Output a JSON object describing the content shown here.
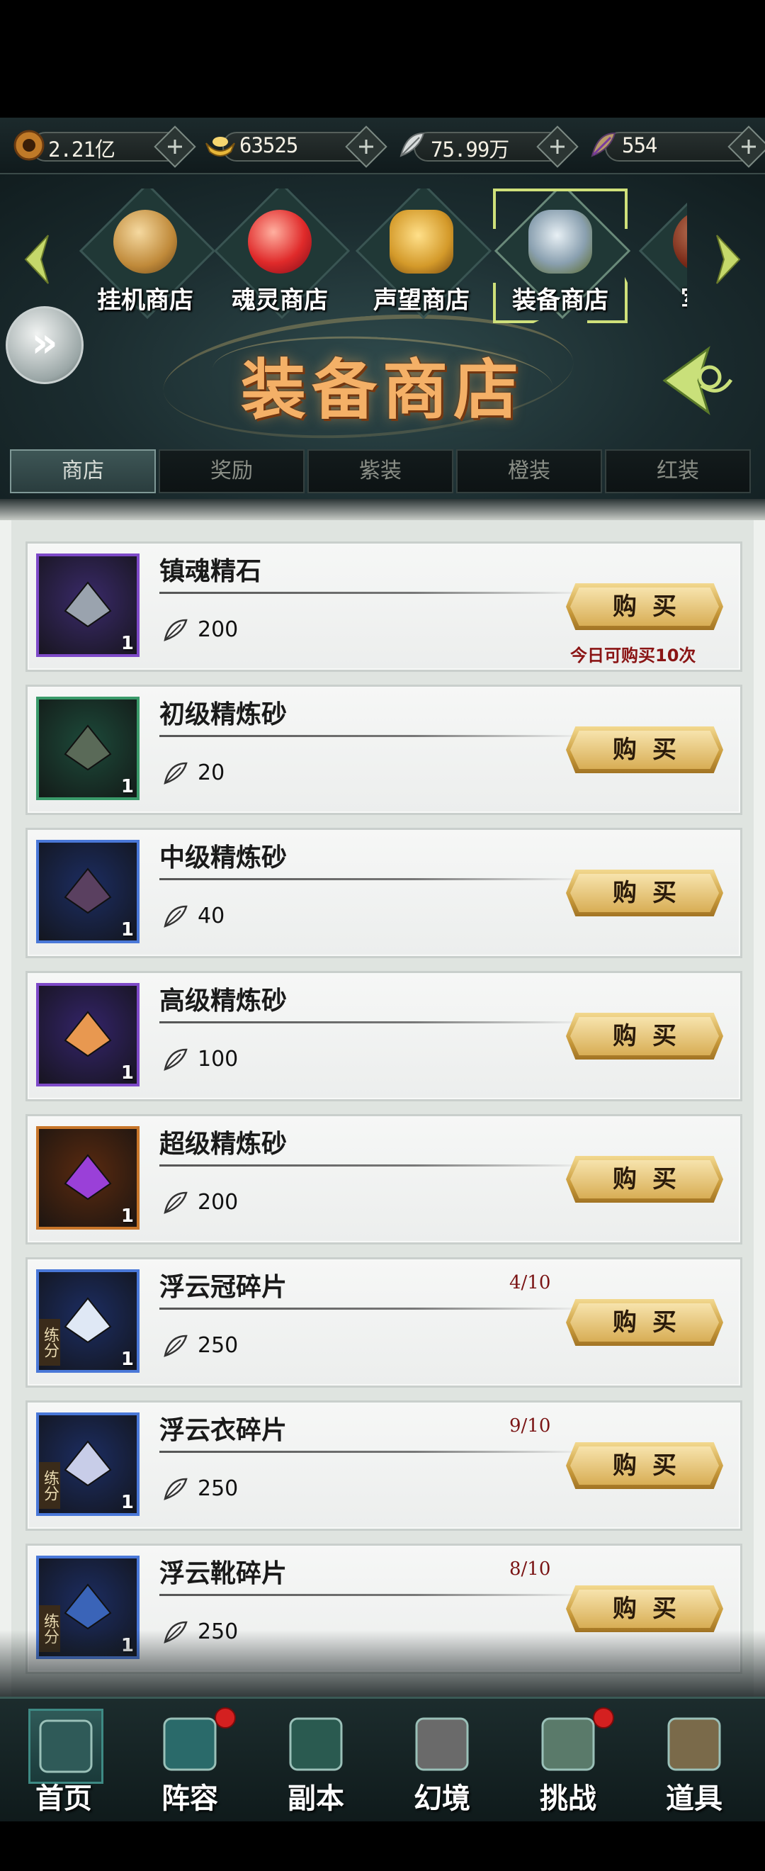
{
  "currencies": [
    {
      "icon": "copper-coin-icon",
      "value": "2.21亿"
    },
    {
      "icon": "gold-ingot-icon",
      "value": "63525"
    },
    {
      "icon": "silver-feather-icon",
      "value": "75.99万"
    },
    {
      "icon": "purple-feather-icon",
      "value": "554"
    }
  ],
  "shops": [
    {
      "label": "挂机商店",
      "active": false
    },
    {
      "label": "魂灵商店",
      "active": false
    },
    {
      "label": "声望商店",
      "active": false
    },
    {
      "label": "装备商店",
      "active": true
    },
    {
      "label": "军团",
      "active": false
    }
  ],
  "shop_title": "装备商店",
  "subtabs": [
    "商店",
    "奖励",
    "紫装",
    "橙装",
    "红装"
  ],
  "buy_label": "购买",
  "items": [
    {
      "name": "镇魂精石",
      "qty": "1",
      "price": "200",
      "frame": "#7e4ac8",
      "bg": "#3a2a6a",
      "gem": "#9aa3ae",
      "limit": "今日可购买10次"
    },
    {
      "name": "初级精炼砂",
      "qty": "1",
      "price": "20",
      "frame": "#3a9a6a",
      "bg": "#1d4a3a",
      "gem": "#5a6a58"
    },
    {
      "name": "中级精炼砂",
      "qty": "1",
      "price": "40",
      "frame": "#4a78d8",
      "bg": "#1c2d62",
      "gem": "#5a4060"
    },
    {
      "name": "高级精炼砂",
      "qty": "1",
      "price": "100",
      "frame": "#7e4ac8",
      "bg": "#34246a",
      "gem": "#e89850"
    },
    {
      "name": "超级精炼砂",
      "qty": "1",
      "price": "200",
      "frame": "#c8762a",
      "bg": "#5a2a10",
      "gem": "#9a40d8"
    },
    {
      "name": "浮云冠碎片",
      "qty": "1",
      "price": "250",
      "frame": "#4a78d8",
      "bg": "#1c2d62",
      "gem": "#dfe8f5",
      "count": "4/10",
      "tag": "练分"
    },
    {
      "name": "浮云衣碎片",
      "qty": "1",
      "price": "250",
      "frame": "#4a78d8",
      "bg": "#1c2d62",
      "gem": "#c8cde8",
      "count": "9/10",
      "tag": "练分"
    },
    {
      "name": "浮云靴碎片",
      "qty": "1",
      "price": "250",
      "frame": "#4a78d8",
      "bg": "#1c2d62",
      "gem": "#3a64b8",
      "count": "8/10",
      "tag": "练分"
    }
  ],
  "nav": [
    {
      "label": "首页",
      "icon": "home-pavilion-icon",
      "dot": false
    },
    {
      "label": "阵容",
      "icon": "lineup-cards-icon",
      "dot": true
    },
    {
      "label": "副本",
      "icon": "dungeon-sword-icon",
      "dot": false
    },
    {
      "label": "幻境",
      "icon": "crossed-swords-icon",
      "dot": false
    },
    {
      "label": "挑战",
      "icon": "scroll-map-icon",
      "dot": true
    },
    {
      "label": "道具",
      "icon": "item-bag-icon",
      "dot": false
    }
  ]
}
